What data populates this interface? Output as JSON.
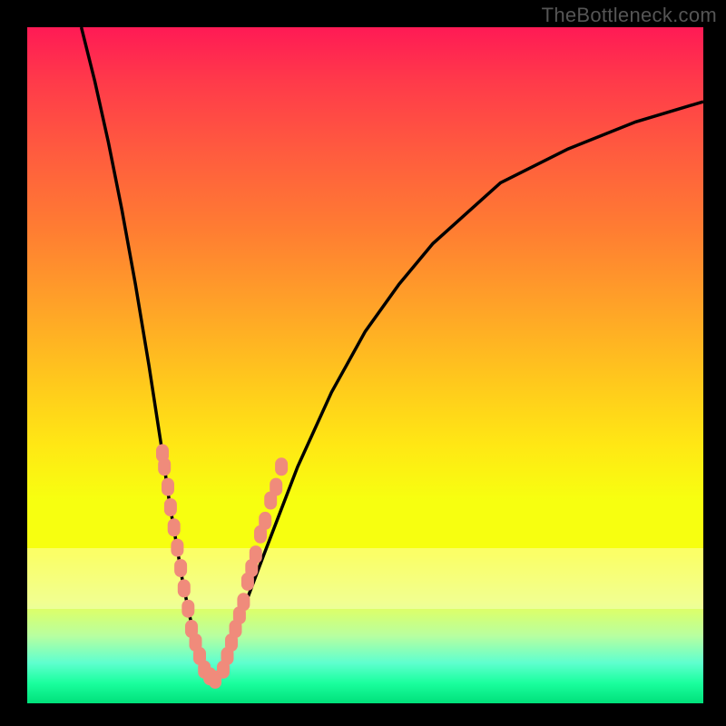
{
  "watermark": "TheBottleneck.com",
  "chart_data": {
    "type": "line",
    "title": "",
    "xlabel": "",
    "ylabel": "",
    "xlim": [
      0,
      100
    ],
    "ylim": [
      0,
      100
    ],
    "series": [
      {
        "name": "left-branch",
        "x": [
          8,
          10,
          12,
          14,
          16,
          18,
          20,
          21,
          22,
          23,
          24,
          25,
          26,
          27
        ],
        "values": [
          100,
          92,
          83,
          73,
          62,
          50,
          37,
          30,
          24,
          18,
          13,
          9,
          6,
          4
        ]
      },
      {
        "name": "right-branch",
        "x": [
          28,
          30,
          32,
          35,
          40,
          45,
          50,
          55,
          60,
          70,
          80,
          90,
          100
        ],
        "values": [
          4,
          8,
          14,
          22,
          35,
          46,
          55,
          62,
          68,
          77,
          82,
          86,
          89
        ]
      }
    ],
    "highlight_clusters": [
      {
        "name": "left-cluster",
        "points": [
          {
            "x": 20.0,
            "y": 37
          },
          {
            "x": 20.3,
            "y": 35
          },
          {
            "x": 20.8,
            "y": 32
          },
          {
            "x": 21.2,
            "y": 29
          },
          {
            "x": 21.7,
            "y": 26
          },
          {
            "x": 22.2,
            "y": 23
          },
          {
            "x": 22.7,
            "y": 20
          },
          {
            "x": 23.2,
            "y": 17
          },
          {
            "x": 23.8,
            "y": 14
          },
          {
            "x": 24.3,
            "y": 11
          },
          {
            "x": 24.9,
            "y": 9
          },
          {
            "x": 25.5,
            "y": 7
          },
          {
            "x": 26.2,
            "y": 5
          },
          {
            "x": 27.0,
            "y": 4
          },
          {
            "x": 27.8,
            "y": 3.5
          }
        ]
      },
      {
        "name": "right-cluster",
        "points": [
          {
            "x": 29.0,
            "y": 5
          },
          {
            "x": 29.6,
            "y": 7
          },
          {
            "x": 30.2,
            "y": 9
          },
          {
            "x": 30.8,
            "y": 11
          },
          {
            "x": 31.4,
            "y": 13
          },
          {
            "x": 32.0,
            "y": 15
          },
          {
            "x": 32.6,
            "y": 18
          },
          {
            "x": 33.2,
            "y": 20
          },
          {
            "x": 33.8,
            "y": 22
          },
          {
            "x": 34.5,
            "y": 25
          },
          {
            "x": 35.2,
            "y": 27
          },
          {
            "x": 36.0,
            "y": 30
          },
          {
            "x": 36.8,
            "y": 32
          },
          {
            "x": 37.6,
            "y": 35
          }
        ]
      }
    ],
    "colors": {
      "curve": "#000000",
      "marker": "#f08b7b"
    }
  }
}
